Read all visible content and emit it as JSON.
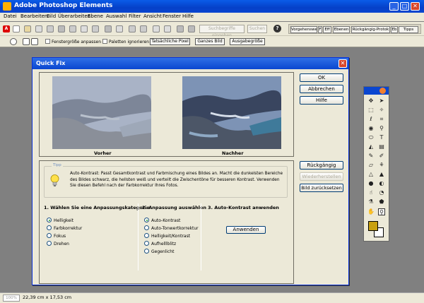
{
  "app": {
    "title": "Adobe Photoshop Elements"
  },
  "menu": [
    "Datei",
    "Bearbeiten",
    "Bild",
    "Überarbeiten",
    "Ebene",
    "Auswahl",
    "Filter",
    "Ansicht",
    "Fenster",
    "Hilfe"
  ],
  "toolbar": {
    "help_search_placeholder": "Suchbegriffe eingeben",
    "search_button": "Suchen",
    "help_icon": "?",
    "palette_tabs": [
      "Vorgehenswe",
      "F",
      "Eff",
      "Ebenen",
      "Rückgängig-Protok",
      "Eb",
      "Tipps"
    ]
  },
  "options_bar": {
    "fit_window": "Fenstergröße anpassen",
    "ignore_palettes": "Paletten ignorieren",
    "actual_pixels": "Tatsächliche Pixel",
    "fit_screen": "Ganzes Bild",
    "print_size": "Ausgabegröße"
  },
  "status": {
    "zoom": "100%",
    "dimensions": "22,39 cm x 17,53 cm"
  },
  "dialog": {
    "title": "Quick Fix",
    "close_icon": "close-icon",
    "before_label": "Vorher",
    "after_label": "Nachher",
    "buttons": {
      "ok": "OK",
      "cancel": "Abbrechen",
      "help": "Hilfe",
      "undo": "Rückgängig",
      "redo": "Wiederherstellen",
      "reset": "Bild zurücksetzen"
    },
    "tips": {
      "label": "Tipp",
      "text": "Auto-Kontrast: Passt Gesamtkontrast und Farbmischung eines Bildes an. Macht die dunkelsten Bereiche des Bildes schwarz, die hellsten weiß und verteilt die Zwischentöne für besseren Kontrast. Verwenden Sie diesen Befehl nach der Farbkorrektur Ihres Fotos."
    },
    "step1": {
      "title": "1. Wählen Sie eine Anpassungskategorie",
      "options": [
        "Helligkeit",
        "Farbkorrektur",
        "Fokus",
        "Drehen"
      ],
      "selected": 0
    },
    "step2": {
      "title": "2. Anpassung auswählen",
      "options": [
        "Auto-Kontrast",
        "Auto-Tonwertkorrektur",
        "Helligkeit/Kontrast",
        "Aufhelllblitz",
        "Gegenlicht"
      ],
      "selected": 0
    },
    "step3": {
      "title": "3. Auto-Kontrast anwenden",
      "apply_button": "Anwenden"
    }
  }
}
